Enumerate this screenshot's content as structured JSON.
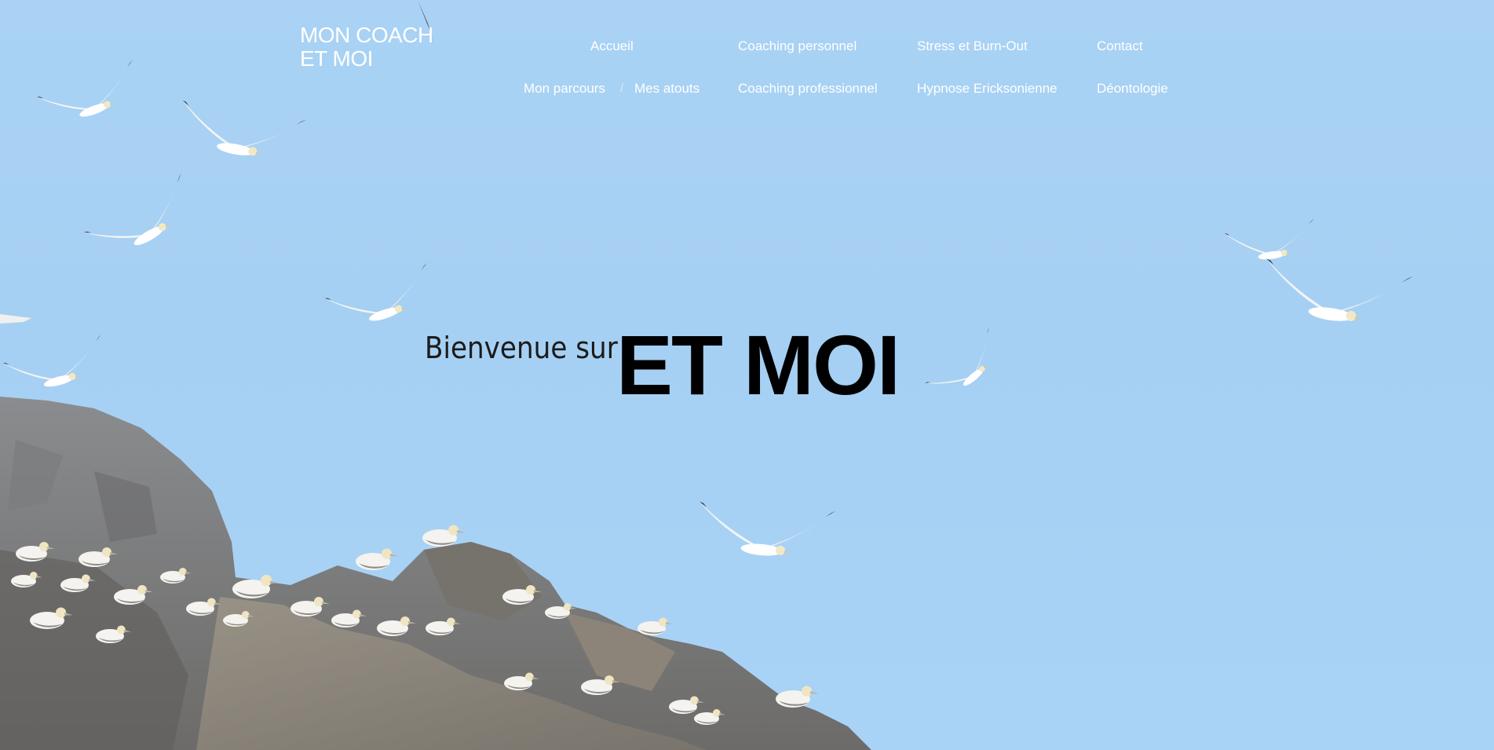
{
  "site": {
    "logo_line1": "MON COACH",
    "logo_line2": "ET MOI"
  },
  "nav": {
    "top_row": [
      "Accueil",
      "Coaching personnel",
      "Stress et Burn-Out",
      "Contact"
    ],
    "bottom_row": [
      "Mon parcours",
      "Mes atouts",
      "Coaching professionnel",
      "Hypnose Ericksonienne",
      "Déontologie"
    ],
    "separator": "/"
  },
  "hero": {
    "welcome": "Bienvenue sur",
    "title": "ET MOI",
    "background": "photo of gannets flying over a rocky cliff against a blue sky"
  },
  "colors": {
    "sky": "#a9d2f4",
    "nav_text": "#ffffff",
    "title_text": "#000000"
  }
}
